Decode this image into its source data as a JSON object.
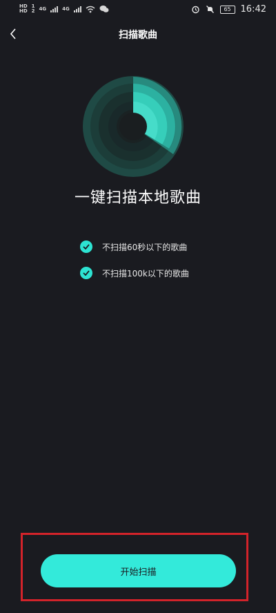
{
  "status_bar": {
    "hd1": "HD",
    "hd2": "HD",
    "net1": "1",
    "net2": "2",
    "net_type1": "4G",
    "net_type2": "4G",
    "battery": "65",
    "time": "16:42"
  },
  "header": {
    "title": "扫描歌曲"
  },
  "main": {
    "headline": "一键扫描本地歌曲",
    "options": [
      {
        "label": "不扫描60秒以下的歌曲",
        "checked": true
      },
      {
        "label": "不扫描100k以下的歌曲",
        "checked": true
      }
    ]
  },
  "actions": {
    "start_label": "开始扫描"
  },
  "colors": {
    "background": "#1a1b20",
    "accent": "#33eada",
    "highlight_border": "#d3232a"
  }
}
